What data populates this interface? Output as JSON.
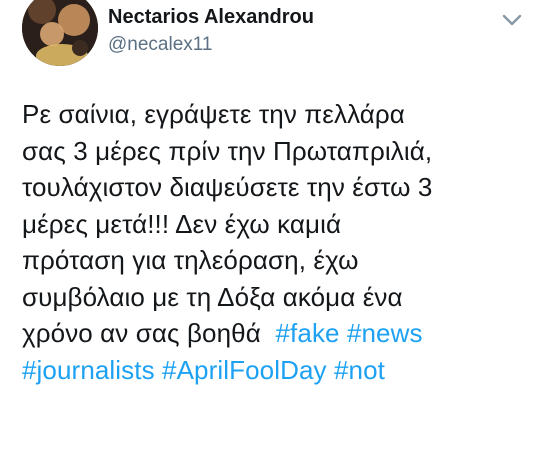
{
  "tweet": {
    "author": {
      "display_name": "Nectarios Alexandrou",
      "handle": "@necalex11",
      "avatar_icon": "profile-photo"
    },
    "menu_icon": "chevron-down-icon",
    "text_lines": [
      "Ρε σαίνια, εγράψετε την πελλάρα",
      "σας 3 μέρες πρίν την Πρωταπριλιά,",
      "τουλάχιστον διαψεύσετε την έστω 3",
      "μέρες μετά!!! Δεν έχω καμιά",
      "πρόταση για τηλεόραση, έχω",
      "συμβόλαιο με τη Δόξα ακόμα ένα"
    ],
    "line7_text": "χρόνο αν σας βοηθά",
    "hashtags": [
      "#fake",
      "#news",
      "#journalists",
      "#AprilFoolDay",
      "#not"
    ],
    "colors": {
      "text": "#14171a",
      "secondary": "#5b7083",
      "link": "#1da1f2"
    }
  }
}
